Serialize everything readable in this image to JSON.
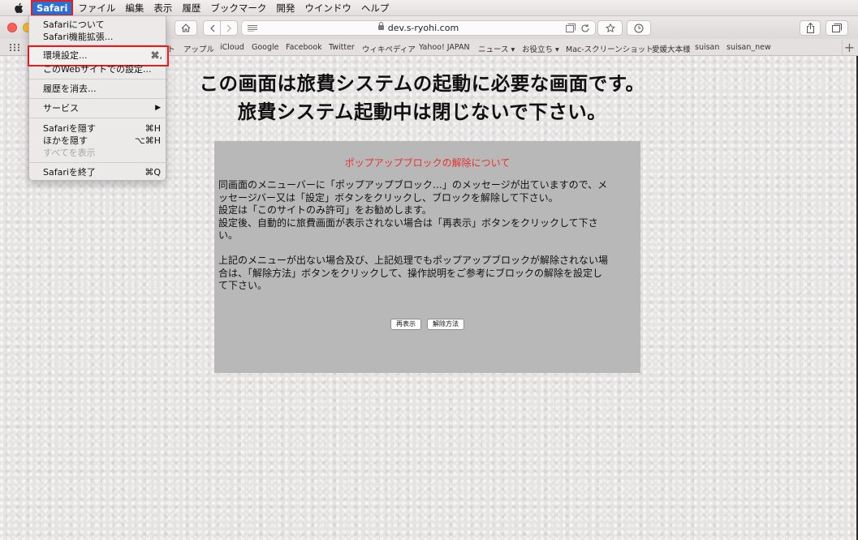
{
  "menubar": {
    "items": [
      "Safari",
      "ファイル",
      "編集",
      "表示",
      "履歴",
      "ブックマーク",
      "開発",
      "ウインドウ",
      "ヘルプ"
    ],
    "active_index": 0
  },
  "toolbar": {
    "address": "dev.s-ryohi.com"
  },
  "bookmarks": [
    "ト",
    "アップル",
    "iCloud",
    "Google",
    "Facebook",
    "Twitter",
    "ウィキペディア",
    "Yahoo! JAPAN",
    "ニュース ▾",
    "お役立ち ▾",
    "Mac-スクリーンショット",
    "愛媛大本様",
    "suisan",
    "suisan_new"
  ],
  "safari_menu": {
    "about": "Safariについて",
    "extensions": "Safari機能拡張...",
    "preferences": "環境設定...",
    "preferences_shortcut": "⌘,",
    "site_settings": "このWebサイトでの設定...",
    "clear_history": "履歴を消去...",
    "services": "サービス",
    "services_arrow": "▶",
    "hide_safari": "Safariを隠す",
    "hide_safari_shortcut": "⌘H",
    "hide_others": "ほかを隠す",
    "hide_others_shortcut": "⌥⌘H",
    "show_all": "すべてを表示",
    "quit": "Safariを終了",
    "quit_shortcut": "⌘Q"
  },
  "page": {
    "heading_line1": "この画面は旅費システムの起動に必要な画面です。",
    "heading_line2": "旅費システム起動中は閉じないで下さい。",
    "notice_title": "ポップアップブロックの解除について",
    "para1_lines": [
      "同画面のメニューバーに「ポップアップブロック…」のメッセージが出ていますので、メ",
      "ッセージバー又は「設定」ボタンをクリックし、ブロックを解除して下さい。",
      "設定は「このサイトのみ許可」をお勧めします。",
      "設定後、自動的に旅費画面が表示されない場合は「再表示」ボタンをクリックして下さ",
      "い。"
    ],
    "para2_lines": [
      "上記のメニューが出ない場合及び、上記処理でもポップアップブロックが解除されない場",
      "合は、「解除方法」ボタンをクリックして、操作説明をご参考にブロックの解除を設定し",
      "て下さい。"
    ],
    "redisplay_button": "再表示",
    "howto_button": "解除方法"
  }
}
